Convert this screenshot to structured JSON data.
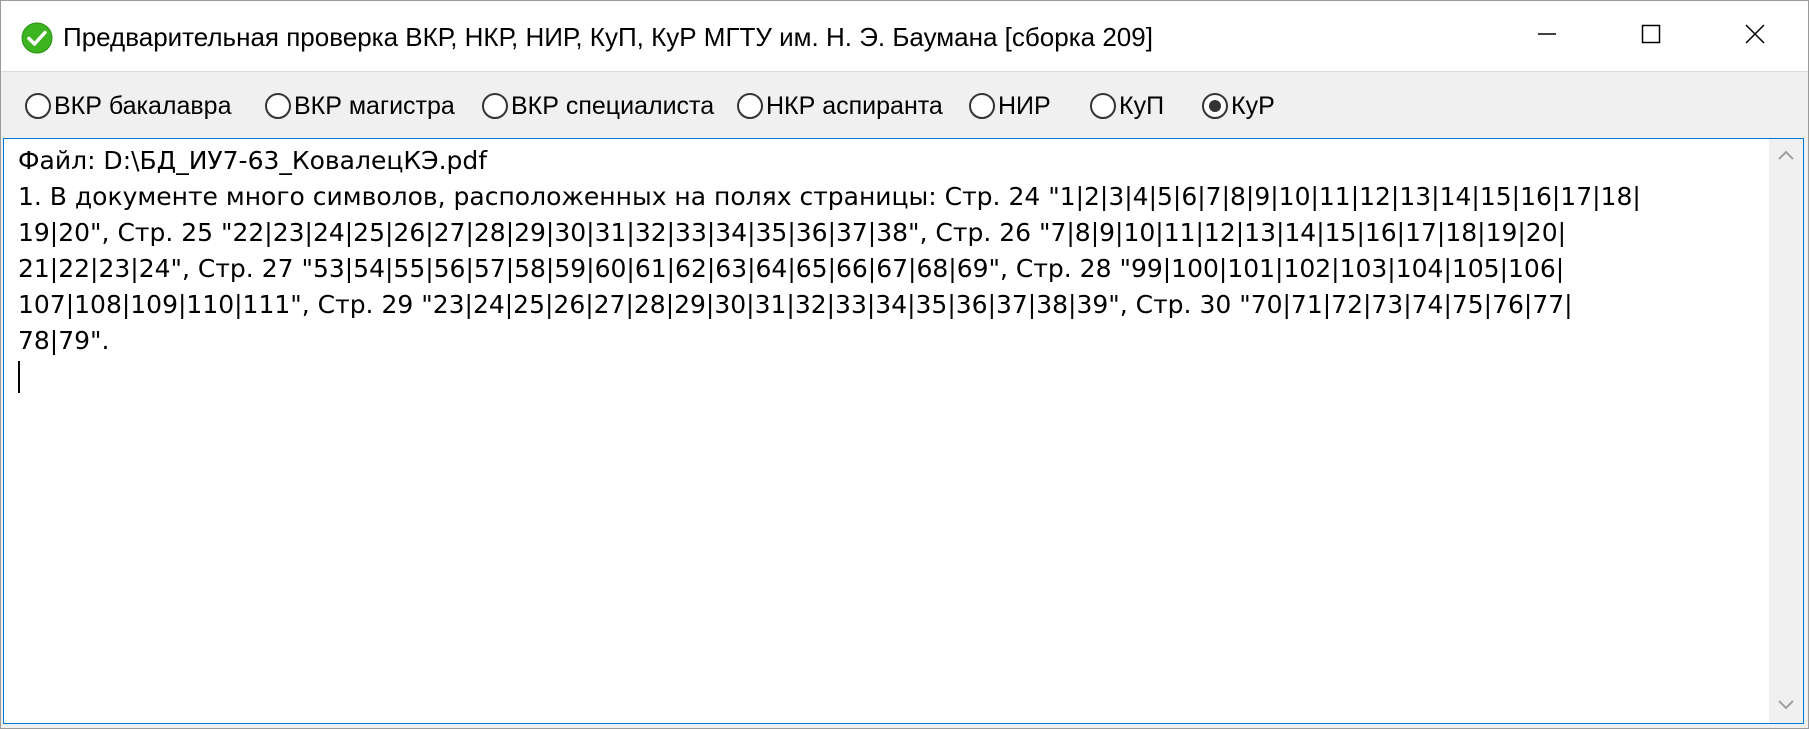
{
  "window": {
    "title": "Предварительная проверка ВКР, НКР, НИР, КуП, КуР МГТУ им. Н. Э. Баумана [сборка 209]",
    "app_icon": "green-check-icon",
    "controls": {
      "minimize": "minimize-icon",
      "maximize": "maximize-icon",
      "close": "close-icon"
    }
  },
  "work_types": [
    {
      "label": "ВКР бакалавра",
      "selected": false
    },
    {
      "label": "ВКР магистра",
      "selected": false
    },
    {
      "label": "ВКР специалиста",
      "selected": false
    },
    {
      "label": "НКР аспиранта",
      "selected": false
    },
    {
      "label": "НИР",
      "selected": false
    },
    {
      "label": "КуП",
      "selected": false
    },
    {
      "label": "КуР",
      "selected": true
    }
  ],
  "output": {
    "lines": [
      "Файл: D:\\БД_ИУ7-63_КовалецКЭ.pdf",
      "1. В документе много символов, расположенных на полях страницы: Стр. 24 \"1|2|3|4|5|6|7|8|9|10|11|12|13|14|15|16|17|18|",
      "19|20\", Стр. 25 \"22|23|24|25|26|27|28|29|30|31|32|33|34|35|36|37|38\", Стр. 26 \"7|8|9|10|11|12|13|14|15|16|17|18|19|20|",
      "21|22|23|24\", Стр. 27 \"53|54|55|56|57|58|59|60|61|62|63|64|65|66|67|68|69\", Стр. 28 \"99|100|101|102|103|104|105|106|",
      "107|108|109|110|111\", Стр. 29 \"23|24|25|26|27|28|29|30|31|32|33|34|35|36|37|38|39\", Стр. 30 \"70|71|72|73|74|75|76|77|",
      "78|79\"."
    ]
  },
  "colors": {
    "title_bg": "#ffffff",
    "window_bg": "#f0f0f0",
    "text_area_border": "#0078d7",
    "icon_green": "#3cb521"
  }
}
